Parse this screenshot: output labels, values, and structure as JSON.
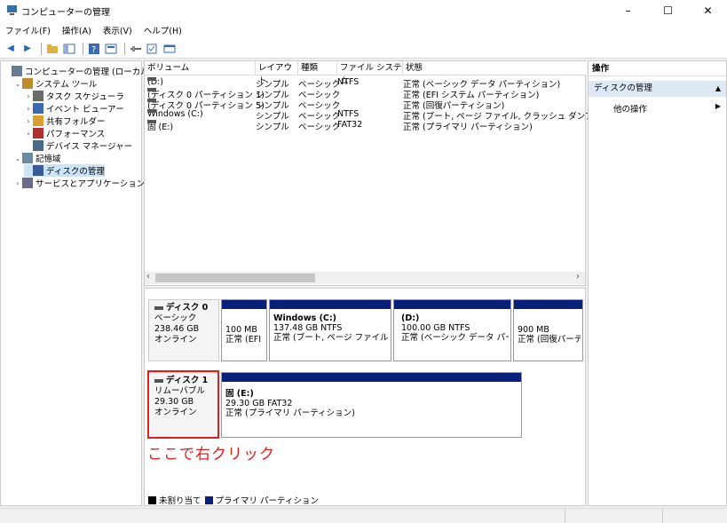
{
  "window": {
    "title": "コンピューターの管理",
    "buttons": [
      "–",
      "☐",
      "✕"
    ]
  },
  "menu": [
    "ファイル(F)",
    "操作(A)",
    "表示(V)",
    "ヘルプ(H)"
  ],
  "tree": [
    {
      "label": "コンピューターの管理 (ローカル)",
      "indent": 0,
      "chev": "",
      "icon": "#6a7a90"
    },
    {
      "label": "システム ツール",
      "indent": 1,
      "chev": "⌄",
      "icon": "#c08a30"
    },
    {
      "label": "タスク スケジューラ",
      "indent": 2,
      "chev": "›",
      "icon": "#6a6a6a"
    },
    {
      "label": "イベント ビューアー",
      "indent": 2,
      "chev": "›",
      "icon": "#3a6ab0"
    },
    {
      "label": "共有フォルダー",
      "indent": 2,
      "chev": "›",
      "icon": "#d8a030"
    },
    {
      "label": "パフォーマンス",
      "indent": 2,
      "chev": "›",
      "icon": "#b03030"
    },
    {
      "label": "デバイス マネージャー",
      "indent": 2,
      "chev": "",
      "icon": "#4a6a8a"
    },
    {
      "label": "記憶域",
      "indent": 1,
      "chev": "⌄",
      "icon": "#6a8aa0"
    },
    {
      "label": "ディスクの管理",
      "indent": 2,
      "chev": "",
      "icon": "#3a5a9a",
      "selected": true
    },
    {
      "label": "サービスとアプリケーション",
      "indent": 1,
      "chev": "›",
      "icon": "#6a6a8a"
    }
  ],
  "list": {
    "headers": [
      "ボリューム",
      "レイアウト",
      "種類",
      "ファイル システム",
      "状態"
    ],
    "rows": [
      [
        "(D:)",
        "シンプル",
        "ベーシック",
        "NTFS",
        "正常 (ベーシック データ パーティション)"
      ],
      [
        "(ディスク 0 パーティション 1)",
        "シンプル",
        "ベーシック",
        "",
        "正常 (EFI システム パーティション)"
      ],
      [
        "(ディスク 0 パーティション 5)",
        "シンプル",
        "ベーシック",
        "",
        "正常 (回復パーティション)"
      ],
      [
        "Windows (C:)",
        "シンプル",
        "ベーシック",
        "NTFS",
        "正常 (ブート, ページ ファイル, クラッシュ ダンプ, ベーシ"
      ],
      [
        "固 (E:)",
        "シンプル",
        "ベーシック",
        "FAT32",
        "正常 (プライマリ パーティション)"
      ]
    ]
  },
  "disks": [
    {
      "name": "ディスク 0",
      "type": "ベーシック",
      "size": "238.46 GB",
      "status": "オンライン",
      "partitions": [
        {
          "title": "",
          "line2": "100 MB",
          "line3": "正常 (EFI"
        },
        {
          "title": "Windows (C:)",
          "line2": "137.48 GB NTFS",
          "line3": "正常 (ブート, ページ ファイル, クラ"
        },
        {
          "title": "(D:)",
          "line2": "100.00 GB NTFS",
          "line3": "正常 (ベーシック データ パーティミ"
        },
        {
          "title": "",
          "line2": "900 MB",
          "line3": "正常 (回復パーテ"
        }
      ]
    },
    {
      "name": "ディスク 1",
      "type": "リムーバブル",
      "size": "29.30 GB",
      "status": "オンライン",
      "partitions": [
        {
          "title": "固 (E:)",
          "line2": "29.30 GB FAT32",
          "line3": "正常 (プライマリ パーティション)"
        }
      ]
    }
  ],
  "annotation": "ここで右クリック",
  "legend": {
    "unallocated": "未割り当て",
    "primary": "プライマリ パーティション"
  },
  "actions": {
    "header": "操作",
    "section": "ディスクの管理",
    "more": "他の操作"
  },
  "colors": {
    "partition_bar": "#0a1f7a",
    "unallocated": "#000000",
    "annotation": "#e02020"
  }
}
